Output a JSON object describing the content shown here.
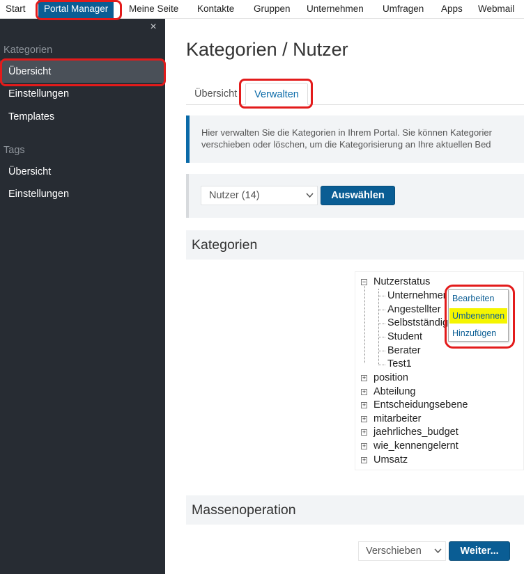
{
  "topnav": {
    "items": [
      "Start",
      "Portal Manager",
      "Meine Seite",
      "Kontakte",
      "Gruppen",
      "Unternehmen",
      "Umfragen",
      "Apps",
      "Webmail"
    ],
    "active_index": 1
  },
  "sidebar": {
    "close_icon": "×",
    "sections": [
      {
        "title": "Kategorien",
        "items": [
          "Übersicht",
          "Einstellungen",
          "Templates"
        ]
      },
      {
        "title": "Tags",
        "items": [
          "Übersicht",
          "Einstellungen"
        ]
      }
    ],
    "active_item": "Kategorien/Übersicht"
  },
  "main": {
    "title": "Kategorien / Nutzer",
    "tabs": [
      "Übersicht",
      "Verwalten"
    ],
    "active_tab": "Verwalten",
    "info_line1": "Hier verwalten Sie die Kategorien in Ihrem Portal. Sie können Kategorier",
    "info_line2": "verschieben oder löschen, um die Kategorisierung an Ihre aktuellen Bed",
    "select_value": "Nutzer (14)",
    "select_button": "Auswählen",
    "section_categories": "Kategorien",
    "section_mass": "Massenoperation",
    "mass_select_value": "Verschieben",
    "mass_button": "Weiter...",
    "dropdown_icon": "chevron-down-icon"
  },
  "tree": {
    "root_expanded": {
      "label": "Nutzerstatus",
      "toggle": "−"
    },
    "children": [
      "Unternehmer",
      "Angestellter",
      "Selbstständig",
      "Student",
      "Berater",
      "Test1"
    ],
    "collapsed": [
      "position",
      "Abteilung",
      "Entscheidungsebene",
      "mitarbeiter",
      "jaehrliches_budget",
      "wie_kennengelernt",
      "Umsatz"
    ],
    "collapsed_toggle": "+"
  },
  "context_menu": {
    "items": [
      "Bearbeiten",
      "Umbenennen",
      "Hinzufügen"
    ],
    "highlighted": "Umbenennen"
  },
  "colors": {
    "accent": "#0a5d94",
    "sidebar_bg": "#272c33",
    "annotation_red": "#e31b1b",
    "highlight_yellow": "#f5f500"
  }
}
